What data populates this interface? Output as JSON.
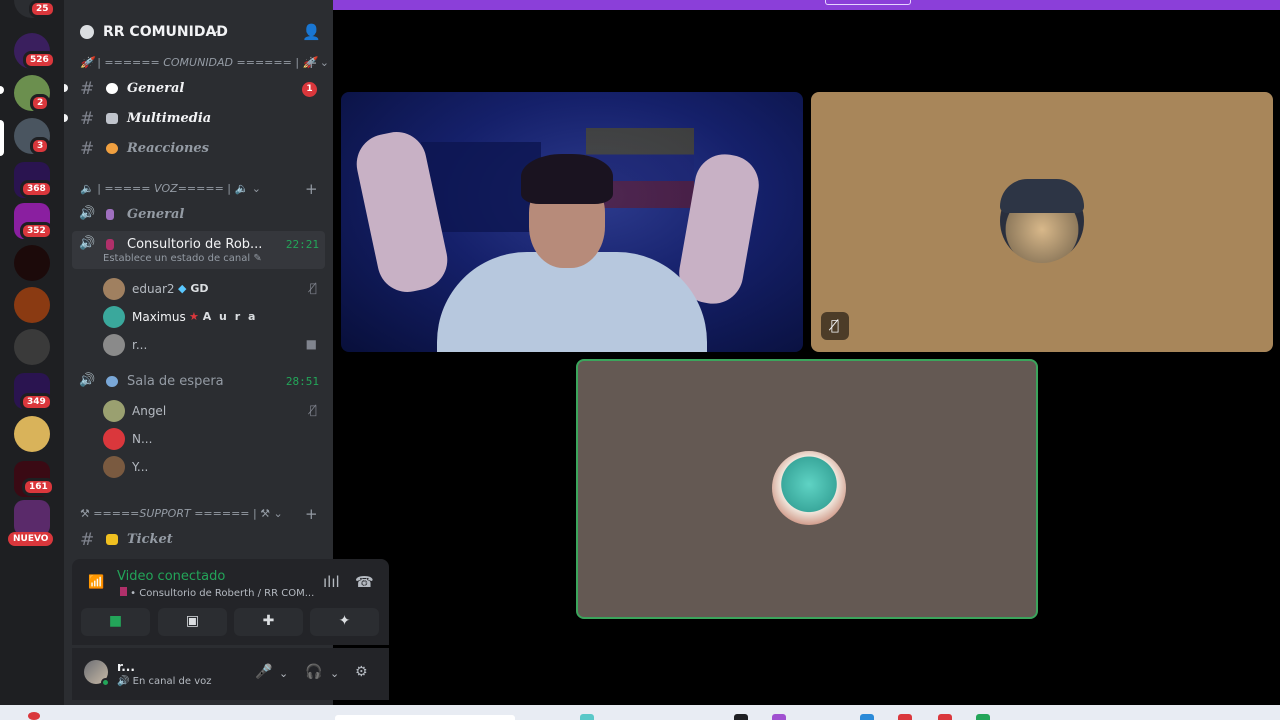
{
  "rail": {
    "top_badge": "25",
    "servers": [
      {
        "badge": "526",
        "color": "#3a1f5e"
      },
      {
        "badge": "2",
        "color": "#6b8f4e"
      },
      {
        "badge": "3",
        "color": "#4a5560"
      },
      {
        "badge": "368",
        "color": "#2a1450"
      },
      {
        "badge": "352",
        "color": "#8a1fa0"
      },
      {
        "badge": "",
        "color": "#1c0a0a"
      },
      {
        "badge": "",
        "color": "#8a3a12"
      },
      {
        "badge": "",
        "color": "#3a3a3a"
      },
      {
        "badge": "349",
        "color": "#2a1450"
      },
      {
        "badge": "",
        "color": "#d9b35a"
      },
      {
        "badge": "161",
        "color": "#3a0a14"
      },
      {
        "badge": "",
        "color": "#5a2a6a"
      }
    ],
    "new_label": "NUEVO"
  },
  "server": {
    "name": "RR COMUNIDAD"
  },
  "categories": {
    "comunidad": "| ====== COMUNIDAD ====== |",
    "voz": "| ===== VOZ===== |",
    "support": "=====SUPPORT ====== |"
  },
  "text_channels": [
    {
      "name": "General",
      "unread": "1",
      "emoji_color": "#ffffff"
    },
    {
      "name": "Multimedia",
      "unread": "",
      "emoji_color": "#c0c4cc"
    },
    {
      "name": "Reacciones",
      "unread": "",
      "emoji_color": "#f0a040"
    }
  ],
  "voice_channels": {
    "general": {
      "name": "General"
    },
    "consultorio": {
      "name": "Consultorio de Rob...",
      "time": "22:21",
      "status": "Establece un estado de canal"
    },
    "sala": {
      "name": "Sala de espera",
      "time": "28:51"
    }
  },
  "consultorio_users": [
    {
      "name": "eduar2",
      "tag": "GD",
      "color": "#a08060"
    },
    {
      "name": "Maximus",
      "tag": "A u r a",
      "color": "#3aa89c"
    },
    {
      "name": "r...",
      "tag": "",
      "color": "#8a8a8a"
    }
  ],
  "sala_users": [
    {
      "name": "Angel",
      "color": "#9aa070"
    },
    {
      "name": "N...",
      "color": "#da373c"
    },
    {
      "name": "Y...",
      "color": "#7a5a40"
    }
  ],
  "support_channels": [
    {
      "name": "Ticket"
    }
  ],
  "voice_panel": {
    "title": "Video conectado",
    "path": "Consultorio de Roberth / RR COM..."
  },
  "user_area": {
    "name": "r...",
    "status": "En canal de voz"
  }
}
